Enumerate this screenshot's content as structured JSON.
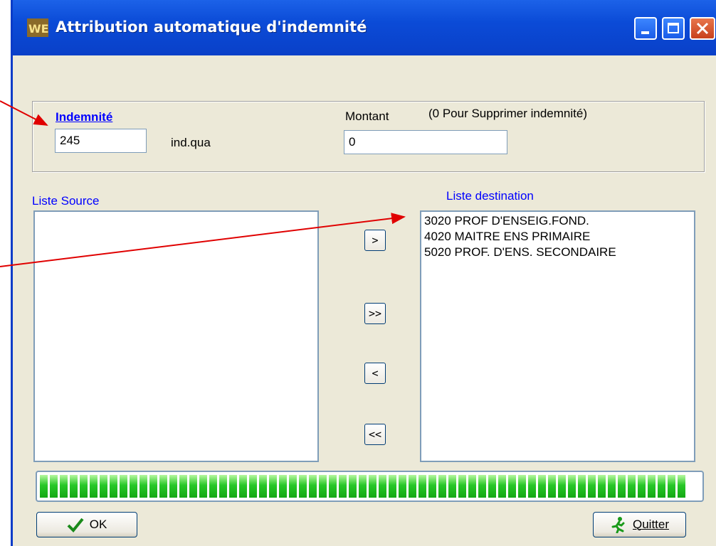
{
  "window": {
    "title": "Attribution automatique d'indemnité"
  },
  "indemnite": {
    "label": "Indemnité",
    "value": "245",
    "code": "ind.qua"
  },
  "montant": {
    "label": "Montant",
    "hint": "(0 Pour Supprimer indemnité)",
    "value": "0"
  },
  "source": {
    "label": "Liste Source",
    "items": []
  },
  "destination": {
    "label": "Liste destination",
    "items": [
      "3020 PROF D'ENSEIG.FOND.",
      "4020 MAITRE ENS PRIMAIRE",
      "5020 PROF. D'ENS. SECONDAIRE"
    ]
  },
  "transfer_buttons": {
    "add": ">",
    "add_all": ">>",
    "remove": "<",
    "remove_all": "<<"
  },
  "progress": {
    "percent": 100,
    "color": "#28c828"
  },
  "buttons": {
    "ok": "OK",
    "quit": "Quitter"
  },
  "colors": {
    "titlebar": "#0a40c8",
    "annotation_arrow": "#e00000"
  }
}
